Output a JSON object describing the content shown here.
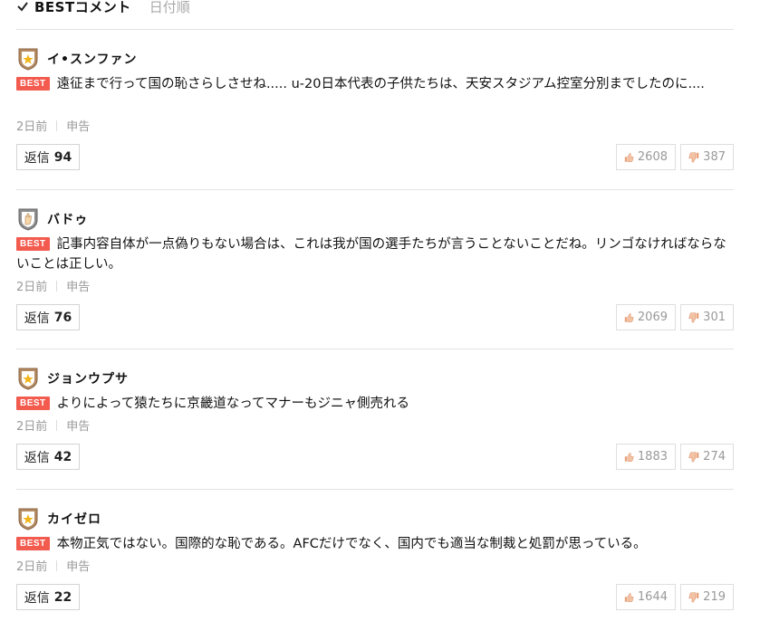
{
  "header": {
    "best_label": "BESTコメント",
    "date_label": "日付順"
  },
  "comments": [
    {
      "author": "イ•スンファン",
      "badge": "gold-star-shield",
      "best_tag": "BEST",
      "text": "遠征まで行って国の恥さらしさせね..... u-20日本代表の子供たちは、天安スタジアム控室分別までしたのに....",
      "time": "2日前",
      "report": "申告",
      "reply_label": "返信",
      "reply_count": "94",
      "likes": "2608",
      "dislikes": "387"
    },
    {
      "author": "バドゥ",
      "badge": "silver-hand-shield",
      "best_tag": "BEST",
      "text": "記事内容自体が一点偽りもない場合は、これは我が国の選手たちが言うことないことだね。リンゴなければならないことは正しい。",
      "time": "2日前",
      "report": "申告",
      "reply_label": "返信",
      "reply_count": "76",
      "likes": "2069",
      "dislikes": "301"
    },
    {
      "author": "ジョンウプサ",
      "badge": "gold-star-shield",
      "best_tag": "BEST",
      "text": "よりによって猿たちに京畿道なってマナーもジニャ側売れる",
      "time": "2日前",
      "report": "申告",
      "reply_label": "返信",
      "reply_count": "42",
      "likes": "1883",
      "dislikes": "274"
    },
    {
      "author": "カイゼロ",
      "badge": "gold-star-shield",
      "best_tag": "BEST",
      "text": "本物正気ではない。国際的な恥である。AFCだけでなく、国内でも適当な制裁と処罰が思っている。",
      "time": "2日前",
      "report": "申告",
      "reply_label": "返信",
      "reply_count": "22",
      "likes": "1644",
      "dislikes": "219"
    }
  ]
}
